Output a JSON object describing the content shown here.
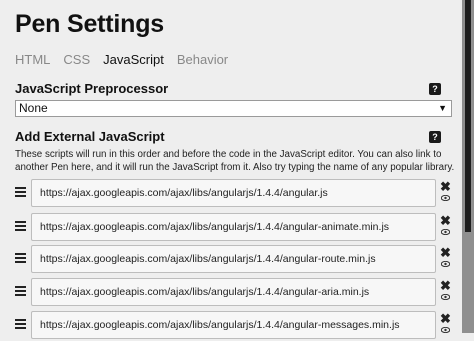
{
  "settings": {
    "title": "Pen Settings",
    "tabs": [
      {
        "label": "HTML",
        "active": false
      },
      {
        "label": "CSS",
        "active": false
      },
      {
        "label": "JavaScript",
        "active": true
      },
      {
        "label": "Behavior",
        "active": false
      }
    ],
    "preprocessor": {
      "label": "JavaScript Preprocessor",
      "help": "?",
      "selected": "None"
    },
    "external": {
      "label": "Add External JavaScript",
      "help": "?",
      "description": "These scripts will run in this order and before the code in the JavaScript editor. You can also link to another Pen here, and it will run the JavaScript from it. Also try typing the name of any popular library.",
      "urls": [
        "https://ajax.googleapis.com/ajax/libs/angularjs/1.4.4/angular.js",
        "https://ajax.googleapis.com/ajax/libs/angularjs/1.4.4/angular-animate.min.js",
        "https://ajax.googleapis.com/ajax/libs/angularjs/1.4.4/angular-route.min.js",
        "https://ajax.googleapis.com/ajax/libs/angularjs/1.4.4/angular-aria.min.js",
        "https://ajax.googleapis.com/ajax/libs/angularjs/1.4.4/angular-messages.min.js"
      ],
      "remove_glyph": "✖"
    }
  },
  "colors": {
    "panel_bg": "#eeeeee",
    "active_tab": "#111111",
    "inactive_tab": "#888888"
  }
}
